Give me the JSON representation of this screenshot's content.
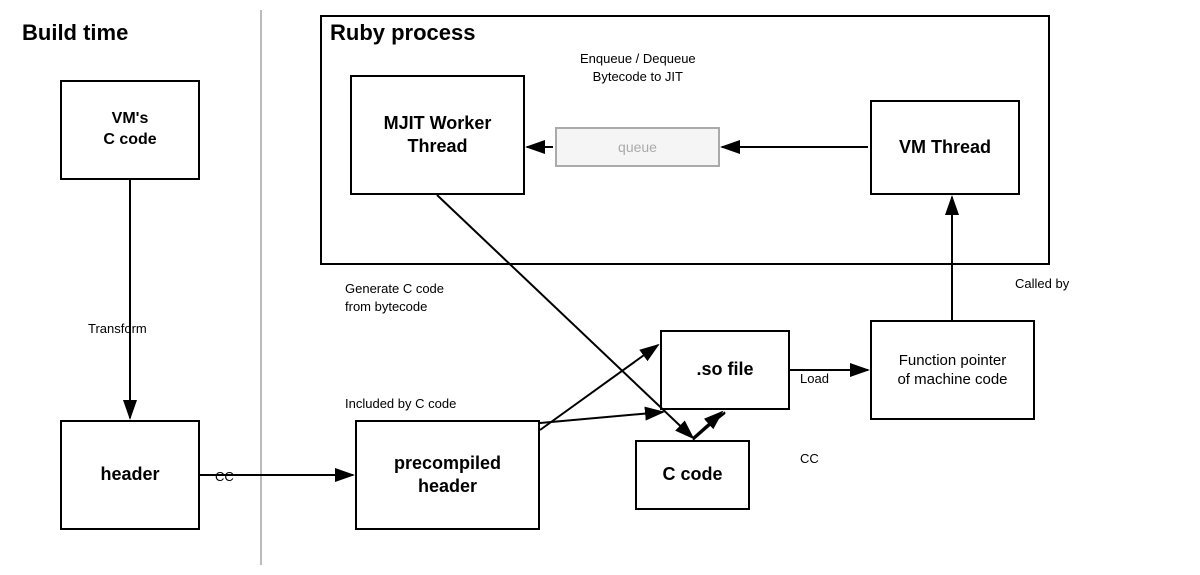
{
  "labels": {
    "build_time": "Build time",
    "ruby_process": "Ruby process",
    "vms_c_code": "VM's\nC code",
    "header": "header",
    "mjit_worker_thread": "MJIT Worker\nThread",
    "vm_thread": "VM Thread",
    "so_file": ".so file",
    "precompiled_header": "precompiled\nheader",
    "c_code": "C code",
    "function_pointer": "Function pointer\nof machine code",
    "transform_label": "Transform",
    "cc_label": "CC",
    "cc_label2": "CC",
    "load_label": "Load",
    "called_by_label": "Called by",
    "generate_c_code_label": "Generate C code\nfrom bytecode",
    "included_by_label": "Included by C code",
    "enqueue_label": "Enqueue / Dequeue\nBytecode to JIT",
    "queue_label": "queue"
  }
}
